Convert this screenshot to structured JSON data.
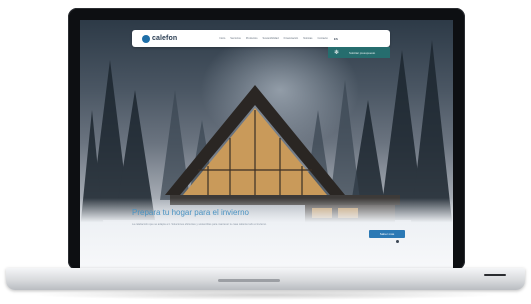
{
  "brand": {
    "name": "calefon",
    "accent": "#1f6fa8"
  },
  "nav": {
    "items": [
      "Inicio",
      "Servicios",
      "Productos",
      "Sostenibilidad",
      "Financiación",
      "Noticias",
      "Contacto"
    ],
    "language": "ES",
    "cta_label": "Solicitar presupuesto",
    "cta_icon": "snowflake-icon",
    "cta_color": "#266d6e"
  },
  "hero": {
    "title": "Prepara tu hogar para el invierno",
    "subtitle": "La calefacción que se adapta a ti. Soluciones eficientes y sostenibles para mantener tu casa caliente todo el invierno.",
    "button_label": "Saber más",
    "title_color": "#4a93c2"
  }
}
